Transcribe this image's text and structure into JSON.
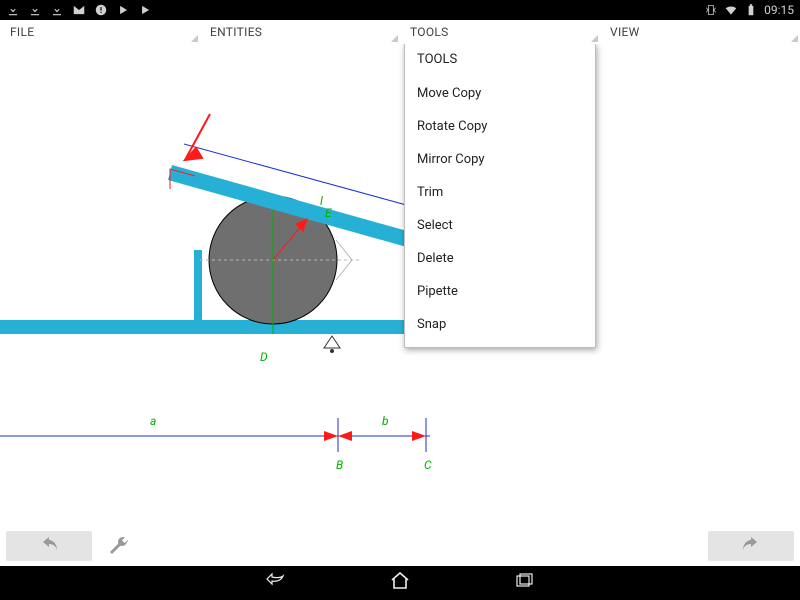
{
  "status": {
    "time": "09:15"
  },
  "menu": {
    "items": [
      "FILE",
      "ENTITIES",
      "TOOLS",
      "VIEW"
    ]
  },
  "dropdown": {
    "header": "TOOLS",
    "items": [
      "Move Copy",
      "Rotate Copy",
      "Mirror Copy",
      "Trim",
      "Select",
      "Delete",
      "Pipette",
      "Snap"
    ]
  },
  "labels": {
    "a": "a",
    "b": "b",
    "B": "B",
    "C": "C",
    "D": "D",
    "E": "E",
    "l": "l"
  },
  "colors": {
    "beam": "#27b0d6",
    "steel": "#6f6f6f",
    "label": "#00b000",
    "dim": "#1b33d1",
    "arrow": "#ff1a1a"
  }
}
